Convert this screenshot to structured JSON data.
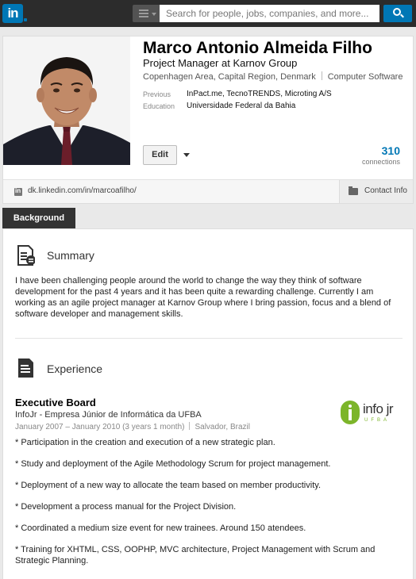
{
  "topbar": {
    "logo": "in",
    "search_placeholder": "Search for people, jobs, companies, and more..."
  },
  "profile": {
    "name": "Marco Antonio Almeida Filho",
    "headline": "Project Manager at Karnov Group",
    "location": "Copenhagen Area, Capital Region, Denmark",
    "industry": "Computer Software",
    "previous_label": "Previous",
    "previous_value": "InPact.me, TecnoTRENDS, Microting A/S",
    "education_label": "Education",
    "education_value": "Universidade Federal da Bahia",
    "edit_label": "Edit",
    "connections_count": "310",
    "connections_label": "connections",
    "public_url": "dk.linkedin.com/in/marcoafilho/",
    "contact_info_label": "Contact Info"
  },
  "background": {
    "tab_label": "Background",
    "summary_title": "Summary",
    "summary_text": "I have been challenging people around the world to change the way they think of software development for the past 4 years and it has been quite a rewarding challenge. Currently I am working as an agile project manager at Karnov Group where I bring passion, focus and a blend of software developer and management skills.",
    "experience_title": "Experience",
    "job": {
      "title": "Executive Board",
      "company": "InfoJr - Empresa Júnior de Informática da UFBA",
      "dates": "January 2007 – January 2010 (3 years 1 month)",
      "location": "Salvador, Brazil",
      "logo_text": "info jr",
      "logo_sub": "UFBA",
      "bullets": [
        "* Participation in the creation and execution of a new strategic plan.",
        "* Study and deployment of the Agile Methodology Scrum for project management.",
        "* Deployment of a new way to allocate the team based on member productivity.",
        "* Development a process manual for the Project Division.",
        "* Coordinated a medium size event for new trainees. Around 150 atendees.",
        "* Training for XHTML, CSS, OOPHP, MVC architecture, Project Management with Scrum and Strategic Planning."
      ]
    }
  }
}
